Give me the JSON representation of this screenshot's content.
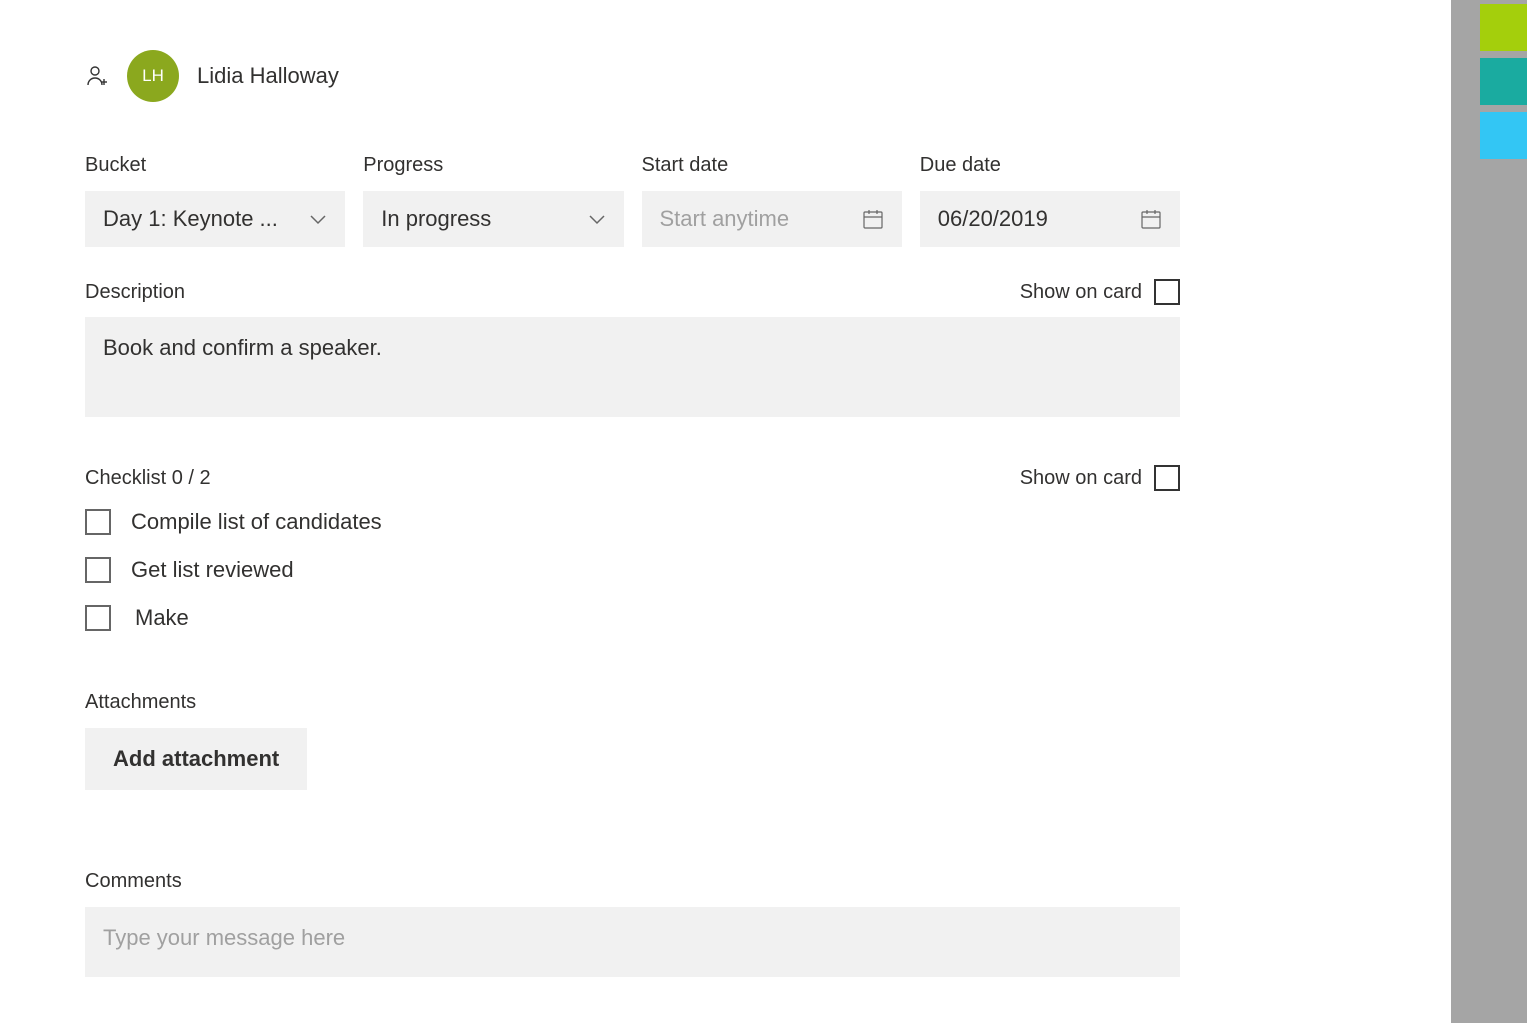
{
  "assignee": {
    "initials": "LH",
    "name": "Lidia Halloway"
  },
  "fields": {
    "bucket": {
      "label": "Bucket",
      "value": "Day 1: Keynote ..."
    },
    "progress": {
      "label": "Progress",
      "value": "In progress"
    },
    "start_date": {
      "label": "Start date",
      "value": "",
      "placeholder": "Start anytime"
    },
    "due_date": {
      "label": "Due date",
      "value": "06/20/2019"
    }
  },
  "description": {
    "label": "Description",
    "value": "Book and confirm a speaker.",
    "show_on_card_label": "Show on card"
  },
  "checklist": {
    "label": "Checklist 0 / 2",
    "show_on_card_label": "Show on card",
    "items": [
      {
        "text": "Compile list of candidates",
        "checked": false
      },
      {
        "text": "Get list reviewed",
        "checked": false
      },
      {
        "text": "Make",
        "checked": false
      }
    ]
  },
  "attachments": {
    "label": "Attachments",
    "button_label": "Add attachment"
  },
  "comments": {
    "label": "Comments",
    "placeholder": "Type your message here"
  },
  "side_tabs": {
    "colors": [
      "#a4cf0c",
      "#1aaba0",
      "#33c6f4"
    ]
  }
}
